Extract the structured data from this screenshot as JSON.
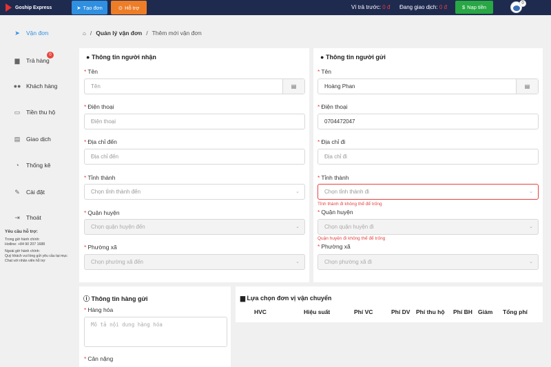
{
  "app": {
    "name": "Goship Express"
  },
  "topbar": {
    "create_label": "Tạo đơn",
    "support_label": "Hỗ trợ",
    "prepay_label": "Ví trả trước:",
    "prepay_value": "0 đ",
    "transacting_label": "Đang giao dịch:",
    "transacting_value": "0 đ",
    "topup_label": "Nạp tiền",
    "notify_count": "0"
  },
  "sidebar": {
    "items": [
      {
        "label": "Vận đơn",
        "icon": "paper-plane-icon"
      },
      {
        "label": "Trả hàng",
        "icon": "truck-icon",
        "badge": "0"
      },
      {
        "label": "Khách hàng",
        "icon": "users-icon"
      },
      {
        "label": "Tiền thu hộ",
        "icon": "money-icon"
      },
      {
        "label": "Giao dịch",
        "icon": "receipt-icon"
      },
      {
        "label": "Thống kê",
        "icon": "pie-chart-icon"
      },
      {
        "label": "Cài đặt",
        "icon": "wrench-icon"
      },
      {
        "label": "Thoát",
        "icon": "sign-out-icon"
      }
    ],
    "support": {
      "title": "Yêu cầu hỗ trợ:",
      "office_hours": "Trong giờ hành chính:",
      "hotline": "Hotline: +84 90 207 1688",
      "after_hours": "Ngoài giờ hành chính:",
      "after_text": "Quý khách vui lòng gửi yêu cầu tại mục Chat với nhân viên hỗ trợ"
    }
  },
  "breadcrumb": {
    "parent": "Quản lý vận đơn",
    "current": "Thêm mới vận đơn"
  },
  "receiver": {
    "title": "Thông tin người nhận",
    "name_label": "Tên",
    "name_placeholder": "Tên",
    "phone_label": "Điện thoại",
    "phone_placeholder": "Điện thoại",
    "address_label": "Địa chỉ đến",
    "address_placeholder": "Địa chỉ đến",
    "province_label": "Tỉnh thành",
    "province_placeholder": "Chọn tỉnh thành đến",
    "district_label": "Quận huyện",
    "district_placeholder": "Chọn quận huyện đến",
    "ward_label": "Phường xã",
    "ward_placeholder": "Chọn phường xã đến"
  },
  "sender": {
    "title": "Thông tin người gửi",
    "name_label": "Tên",
    "name_value": "Hoàng Phan",
    "phone_label": "Điện thoại",
    "phone_value": "0704472047",
    "address_label": "Địa chỉ đi",
    "address_placeholder": "Địa chỉ đi",
    "province_label": "Tỉnh thành",
    "province_placeholder": "Chọn tỉnh thành đi",
    "province_error": "Tỉnh thành đi không thể để trống",
    "district_label": "Quận huyện",
    "district_placeholder": "Chọn quận huyện đi",
    "district_error": "Quận huyện đi không thể để trống",
    "ward_label": "Phường xã",
    "ward_placeholder": "Chọn phường xã đi"
  },
  "goods": {
    "title": "Thông tin hàng gửi",
    "items_label": "Hàng hóa",
    "items_placeholder": "Mô tả nội dung hàng hóa",
    "weight_label": "Cân nặng"
  },
  "carrier": {
    "title": "Lựa chọn đơn vị vận chuyển",
    "columns": [
      "HVC",
      "Hiệu suất",
      "Phí VC",
      "Phí DV",
      "Phí thu hộ",
      "Phí BH",
      "Giảm",
      "Tổng phí"
    ]
  }
}
